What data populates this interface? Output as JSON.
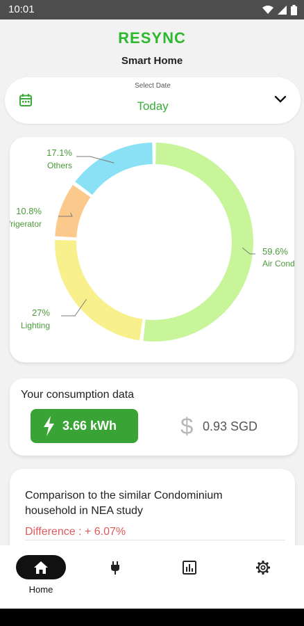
{
  "status_bar": {
    "time": "10:01",
    "icons": [
      "wifi-icon",
      "signal-icon",
      "battery-icon"
    ]
  },
  "header": {
    "title": "RESYNC",
    "subtitle": "Smart Home"
  },
  "date_selector": {
    "caption": "Select Date",
    "value": "Today",
    "icon": "calendar-icon",
    "dropdown_icon": "chevron-down-icon"
  },
  "chart_data": {
    "type": "pie",
    "donut": true,
    "segments": [
      {
        "label": "Air Condi",
        "percent_label": "59.6%",
        "value": 59.6,
        "color": "#c8f59a"
      },
      {
        "label": "Lighting",
        "percent_label": "27%",
        "value": 27,
        "color": "#f8f08c"
      },
      {
        "label": "frigerator",
        "percent_label": "10.8%",
        "value": 10.8,
        "color": "#fbc98c"
      },
      {
        "label": "Others",
        "percent_label": "17.1%",
        "value": 17.1,
        "color": "#8ae1f6"
      }
    ],
    "label_color": "#4a9a3a",
    "legend": "none"
  },
  "consumption": {
    "title": "Your consumption data",
    "energy": "3.66 kWh",
    "energy_icon": "lightning-bolt-icon",
    "currency_symbol": "$",
    "cost": "0.93 SGD"
  },
  "comparison": {
    "text": "Comparison to the similar Condominium household in NEA study",
    "difference": "Difference : + 6.07%"
  },
  "bottom_nav": {
    "items": [
      {
        "label": "Home",
        "icon": "home-icon",
        "active": true
      },
      {
        "label": "",
        "icon": "plug-icon",
        "active": false
      },
      {
        "label": "",
        "icon": "bar-chart-icon",
        "active": false
      },
      {
        "label": "",
        "icon": "settings-icon",
        "active": false
      }
    ]
  },
  "colors": {
    "brand_green": "#2eb82e",
    "button_green": "#3aa335",
    "difference_red": "#e05a5a",
    "background": "#f2f2f2"
  }
}
